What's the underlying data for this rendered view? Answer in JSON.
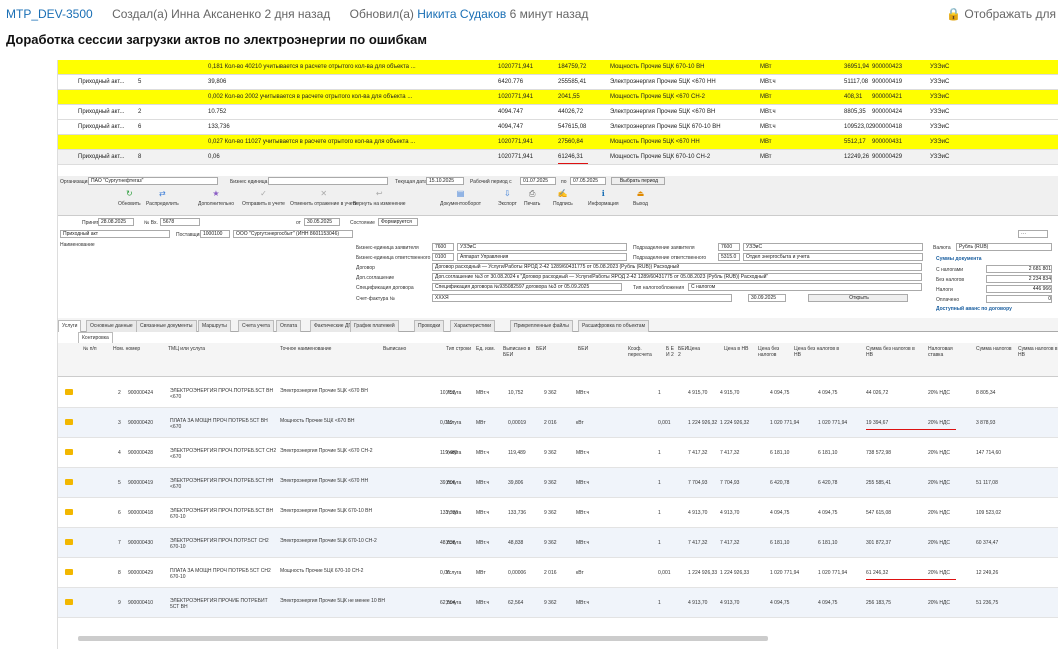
{
  "ticket": {
    "id": "MTP_DEV-3500",
    "created": "Создал(а) Инна Аксаненко 2 дня назад",
    "updated_prefix": "Обновил(а)",
    "updated_user": "Никита Судаков",
    "updated_suffix": "6 минут назад",
    "display": "Отображать для",
    "title": "Доработка сессии загрузки актов по электроэнергии по ошибкам"
  },
  "top_table": [
    {
      "hl": "yel",
      "a": "",
      "b": "",
      "c": "0,181  Кол-во 40210 учитывается в расчете отрытого кол-ва для объекта ...",
      "d": "1020771,941",
      "e": "184759,72",
      "f": "Мощность Прочие 5ЦК 670-10 ВН",
      "g": "МВт",
      "h": "36951,94",
      "i": "900000423",
      "j": "УЗЭиС"
    },
    {
      "hl": "",
      "a": "Приходный акт...",
      "b": "5",
      "c": "39,806",
      "d": "6420.776",
      "e": "255585,41",
      "f": "Электроэнергия Прочие 5ЦК <670 НН",
      "g": "МВт.ч",
      "h": "51117,08",
      "i": "900000419",
      "j": "УЗЭиС"
    },
    {
      "hl": "yel",
      "a": "",
      "b": "",
      "c": "0,002  Кол-во 2002 учитывается в расчете отрытого кол-ва для объекта ...",
      "d": "1020771,941",
      "e": "2041,55",
      "f": "Мощность Прочие 5ЦК <670 СН-2",
      "g": "МВт",
      "h": "408,31",
      "i": "900000421",
      "j": "УЗЭиС"
    },
    {
      "hl": "",
      "a": "Приходный акт...",
      "b": "2",
      "c": "10.752",
      "d": "4094.747",
      "e": "44026,72",
      "f": "Электроэнергия Прочие 5ЦК <670 ВН",
      "g": "МВт.ч",
      "h": "8805,35",
      "i": "900000424",
      "j": "УЗЭиС"
    },
    {
      "hl": "",
      "a": "Приходный акт...",
      "b": "6",
      "c": "133,736",
      "d": "4094,747",
      "e": "547615,08",
      "f": "Электроэнергия Прочие 5ЦК 670-10 ВН",
      "g": "МВт.ч",
      "h": "109523,02",
      "i": "900000418",
      "j": "УЗЭиС"
    },
    {
      "hl": "yel",
      "a": "",
      "b": "",
      "c": "0,027  Кол-во 11027 учитывается в расчете отрытого кол-ва для объекта ...",
      "d": "1020771,941",
      "e": "27560,84",
      "f": "Мощность Прочие 5ЦК <670 НН",
      "g": "МВт",
      "h": "5512,17",
      "i": "900000431",
      "j": "УЗЭиС"
    },
    {
      "hl": "gray",
      "a": "Приходный акт...",
      "b": "8",
      "c": "0,06",
      "d": "1020771,941",
      "e": "61246,31",
      "f": "Мощность Прочие 5ЦК 670-10 СН-2",
      "g": "МВт",
      "h": "12249,26",
      "i": "900000429",
      "j": "УЗЭиС"
    }
  ],
  "filters": {
    "org_label": "Организация",
    "org": "ПАО \"Сургутнефтегаз\"",
    "bu_label": "Бизнес единица",
    "date_label": "Текущая дата",
    "date": "15.10.2025",
    "period_label": "Рабочий период с",
    "from": "01.07.2025",
    "to_label": "по",
    "to": "07.05.2025",
    "period_btn": "Выбрать период"
  },
  "toolbar": [
    "Обновить",
    "Распределить",
    "Дополнительно",
    "Отправить в учете",
    "Отменить отражение в учете",
    "Вернуть на изменение",
    "Документооборот",
    "Экспорт",
    "Печать",
    "Подпись",
    "Информация",
    "Выход"
  ],
  "doc": {
    "accepted_label": "Принят",
    "accepted": "28.08.2025",
    "num_label": "№ Вх.",
    "num": "5678",
    "from_label": "от",
    "from": "30.05.2025",
    "state_label": "Состояние",
    "state": "Формируется",
    "type": "Приходный акт",
    "supplier_label": "Поставщик",
    "supplier_code": "1000100",
    "supplier": "ООО \"Сургутэнергосбыт\" (ИНН 8601153046)",
    "name_label": "Наименование"
  },
  "mid": {
    "be_label": "Бизнес-единица заявителя",
    "be_code": "7600",
    "be": "УЗЭиС",
    "resp_label": "Бизнес-единица ответственного",
    "resp_code": "0100",
    "resp": "Аппарат Управления",
    "contract_label": "Договор",
    "contract": "Договор расходный — Услуги/Работы ЯРОД 2-42 1289/60431775 от 05.08.2023 (Рубль (RUB)) Расходный",
    "agreement_label": "Доп.соглашение",
    "agreement": "Доп.соглашение №3 от 30.08.2024 к \"Договор расходный — Услуги/Работы ЯРОД 2-42 1289/60431775 от 05.08.2023 (Рубль (RUB)) Расходный\"",
    "spec_label": "Спецификация договора",
    "spec": "Спецификация договора №935082597 договора №3 от 05.09.2025",
    "invoice_label": "Счет-фактура №",
    "invoice": "ХХХЯ",
    "invoice_date": "30.09.2025",
    "open_btn": "Открыть",
    "dep_label": "Подразделение заявителя",
    "dep_code": "7600",
    "dep": "УЗЭиС",
    "dep2_label": "Подразделение ответственного",
    "dep2_code": "5315.0",
    "dep2": "Отдел энергосбыта и учета",
    "tax_label": "Тип налогообложения",
    "tax": "С налогом"
  },
  "sums": {
    "currency_label": "Валюта",
    "currency": "Рубль (RUB)",
    "section": "Суммы документа",
    "rows": [
      {
        "l": "С налогами",
        "v": "2 681 801"
      },
      {
        "l": "Без налогов",
        "v": "2 234 834"
      },
      {
        "l": "Налоги",
        "v": "446 966"
      },
      {
        "l": "Оплачено",
        "v": "0"
      }
    ],
    "advance": "Доступный аванс по договору"
  },
  "tabs": [
    "Услуги",
    "Основные данные",
    "Связанные документы",
    "Маршруты",
    "Счета учета",
    "Оплата",
    "Фактические ДПП",
    "График платежей",
    "Проводки",
    "Характеристики",
    "Прикрепленные файлы",
    "Расшифровка по объектам"
  ],
  "subtab": "Контировка",
  "grid_head": [
    "№ п/п",
    "Ном. номер",
    "ТМЦ или услуга",
    "Точное наименование",
    "Выписано",
    "Тип строки",
    "Ед. изм.",
    "Выписано в БЕИ",
    "БЕИ",
    "БЕИ",
    "Коэф. пересчета",
    "Б Е И 2",
    "БЕИ 2",
    "Цена",
    "Цена в НВ",
    "Цена без налогов",
    "Цена без налогов в НВ",
    "Сумма без налогов в НВ",
    "Налоговая ставка",
    "Сумма налогов",
    "Сумма налогов в НВ"
  ],
  "rows": [
    {
      "n": "2",
      "nom": "900000424",
      "tmc": "ЭЛЕКТРОЭНЕРГИЯ ПРОЧ.ПОТРЕБ.5СТ ВН <670",
      "name": "Электроэнергия Прочие 5ЦК <670 ВН",
      "q": "10,752",
      "t": "Услуга",
      "u": "МВт.ч",
      "qb": "10,752",
      "b": "9 362",
      "bu": "МВт.ч",
      "k": "1",
      "p": "4 915,70",
      "pn": "4 915,70",
      "pb": "4 094,75",
      "pbn": "4 094,75",
      "s": "44 026,72",
      "r": "20% НДС",
      "tx": "8 805,34"
    },
    {
      "n": "3",
      "nom": "900000420",
      "tmc": "ПЛАТА ЗА МОЩН ПРОЧ ПОТРЕБ 5СТ ВН <670",
      "name": "Мощность Прочие 5ЦК <670 ВН",
      "q": "0,019",
      "t": "Услуга",
      "u": "МВт",
      "qb": "0,00019",
      "b": "2 016",
      "bu": "кВт",
      "k": "0,001",
      "p": "1 224 926,32",
      "pn": "1 224 926,32",
      "pb": "1 020 771,94",
      "pbn": "1 020 771,94",
      "s": "19 394,67",
      "r": "20% НДС",
      "tx": "3 878,93"
    },
    {
      "n": "4",
      "nom": "900000428",
      "tmc": "ЭЛЕКТРОЭНЕРГИЯ ПРОЧ.ПОТРЕБ.5СТ СН2 <670",
      "name": "Электроэнергия Прочие 5ЦК <670 СН-2",
      "q": "119,489",
      "t": "Услуга",
      "u": "МВт.ч",
      "qb": "119,489",
      "b": "9 362",
      "bu": "МВт.ч",
      "k": "1",
      "p": "7 417,32",
      "pn": "7 417,32",
      "pb": "6 181,10",
      "pbn": "6 181,10",
      "s": "738 572,98",
      "r": "20% НДС",
      "tx": "147 714,60"
    },
    {
      "n": "5",
      "nom": "900000419",
      "tmc": "ЭЛЕКТРОЭНЕРГИЯ ПРОЧ.ПОТРЕБ.5СТ НН <670",
      "name": "Электроэнергия Прочие 5ЦК <670 НН",
      "q": "39,806",
      "t": "Услуга",
      "u": "МВт.ч",
      "qb": "39,806",
      "b": "9 362",
      "bu": "МВт.ч",
      "k": "1",
      "p": "7 704,93",
      "pn": "7 704,93",
      "pb": "6 420,78",
      "pbn": "6 420,78",
      "s": "255 585,41",
      "r": "20% НДС",
      "tx": "51 117,08"
    },
    {
      "n": "6",
      "nom": "900000418",
      "tmc": "ЭЛЕКТРОЭНЕРГИЯ ПРОЧ.ПОТРЕБ.5СТ ВН 670-10",
      "name": "Электроэнергия Прочие 5ЦК 670-10 ВН",
      "q": "133,736",
      "t": "Услуга",
      "u": "МВт.ч",
      "qb": "133,736",
      "b": "9 362",
      "bu": "МВт.ч",
      "k": "1",
      "p": "4 913,70",
      "pn": "4 913,70",
      "pb": "4 094,75",
      "pbn": "4 094,75",
      "s": "547 615,08",
      "r": "20% НДС",
      "tx": "109 523,02"
    },
    {
      "n": "7",
      "nom": "900000430",
      "tmc": "ЭЛЕКТРОЭНЕРГИЯ ПРОЧ.ПОТР.5СТ СН2 670-10",
      "name": "Электроэнергия Прочие 5ЦК 670-10 СН-2",
      "q": "48,838",
      "t": "Услуга",
      "u": "МВт.ч",
      "qb": "48,838",
      "b": "9 362",
      "bu": "МВт.ч",
      "k": "1",
      "p": "7 417,32",
      "pn": "7 417,32",
      "pb": "6 181,10",
      "pbn": "6 181,10",
      "s": "301 872,37",
      "r": "20% НДС",
      "tx": "60 374,47"
    },
    {
      "n": "8",
      "nom": "900000429",
      "tmc": "ПЛАТА ЗА МОЩН ПРОЧ ПОТРЕБ 5СТ СН2 670-10",
      "name": "Мощность Прочие 5ЦК 670-10 СН-2",
      "q": "0,06",
      "t": "Услуга",
      "u": "МВт",
      "qb": "0,00006",
      "b": "2 016",
      "bu": "кВт",
      "k": "0,001",
      "p": "1 224 926,33",
      "pn": "1 224 926,33",
      "pb": "1 020 771,94",
      "pbn": "1 020 771,94",
      "s": "61 246,32",
      "r": "20% НДС",
      "tx": "12 249,26"
    },
    {
      "n": "9",
      "nom": "900000410",
      "tmc": "ЭЛЕКТРОЭНЕРГИЯ ПРОЧИЕ ПОТРЕБИТ 5СТ ВН",
      "name": "Электроэнергия Прочие 5ЦК не менее 10 ВН",
      "q": "62,564",
      "t": "Услуга",
      "u": "МВт.ч",
      "qb": "62,564",
      "b": "9 362",
      "bu": "МВт.ч",
      "k": "1",
      "p": "4 913,70",
      "pn": "4 913,70",
      "pb": "4 094,75",
      "pbn": "4 094,75",
      "s": "256 183,75",
      "r": "20% НДС",
      "tx": "51 236,75"
    }
  ]
}
